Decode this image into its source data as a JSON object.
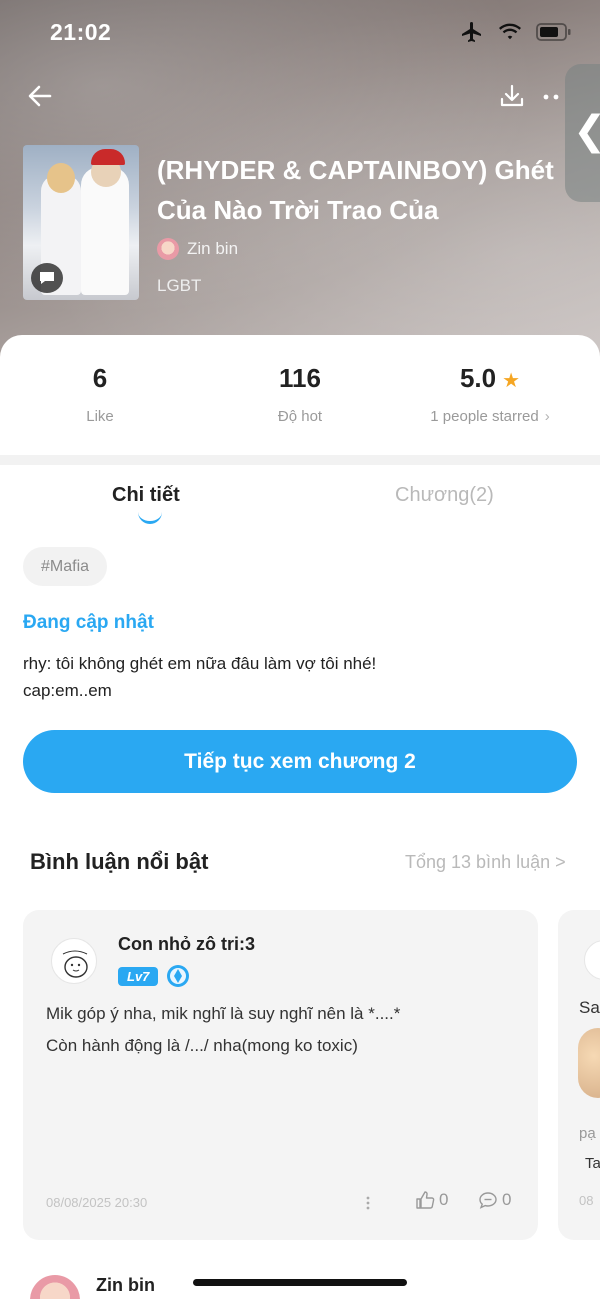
{
  "status_bar": {
    "time": "21:02",
    "icons": [
      "airplane-icon",
      "wifi-icon",
      "battery-icon"
    ]
  },
  "nav": {
    "back_icon": "back-arrow-icon",
    "download_icon": "download-icon",
    "more_icon": "more-dots-icon",
    "side_tab_glyph": "❮"
  },
  "story": {
    "title": "(RHYDER & CAPTAINBOY) Ghét Của Nào Trời Trao Của",
    "author": "Zin bin",
    "genre": "LGBT"
  },
  "stats": {
    "likes": {
      "value": "6",
      "label": "Like"
    },
    "hot": {
      "value": "116",
      "label": "Độ hot"
    },
    "rating": {
      "value": "5.0",
      "label": "1 people starred",
      "star": "★",
      "chevron": "›"
    }
  },
  "tabs": {
    "detail": "Chi tiết",
    "chapters": "Chương(2)"
  },
  "hashtag": "#Mafia",
  "update_status": "Đang cập nhật",
  "description": [
    "rhy: tôi không ghét em nữa đâu làm vợ tôi nhé!",
    "cap:em..em"
  ],
  "continue_button": "Tiếp tục xem chương 2",
  "comments_section": {
    "title": "Bình luận nổi bật",
    "total": "Tổng 13 bình luận >"
  },
  "featured_comment": {
    "username": "Con nhỏ zô tri:3",
    "level": "Lv7",
    "text": [
      "Mik góp ý nha, mik nghĩ là suy nghĩ nên là *....*",
      "Còn hành động là /.../ nha(mong ko toxic)"
    ],
    "timestamp": "08/08/2025 20:30",
    "likes": "0",
    "replies": "0"
  },
  "peek_comment": {
    "text": "Sa",
    "line2": "pạ",
    "line3": "Ta",
    "timestamp": "08"
  },
  "next_comment": {
    "username": "Zin bin"
  },
  "colors": {
    "accent": "#2aa8f2",
    "star": "#f5a623"
  }
}
